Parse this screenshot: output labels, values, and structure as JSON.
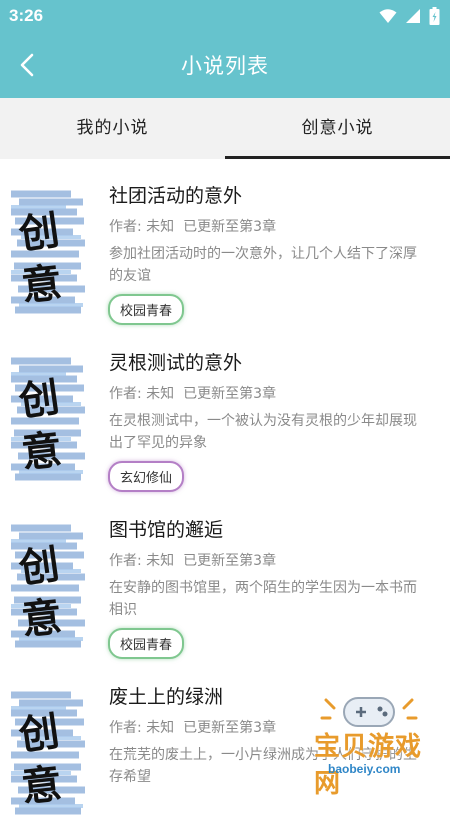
{
  "status_bar": {
    "time": "3:26"
  },
  "app_bar": {
    "title": "小说列表"
  },
  "tabs": [
    {
      "label": "我的小说",
      "active": false
    },
    {
      "label": "创意小说",
      "active": true
    }
  ],
  "cover_text": [
    "创",
    "意"
  ],
  "novels": [
    {
      "title": "社团活动的意外",
      "author": "作者: 未知",
      "update": "已更新至第3章",
      "description": "参加社团活动时的一次意外，让几个人结下了深厚的友谊",
      "tag": "校园青春",
      "tag_color": "#7fc78f"
    },
    {
      "title": "灵根测试的意外",
      "author": "作者: 未知",
      "update": "已更新至第3章",
      "description": "在灵根测试中，一个被认为没有灵根的少年却展现出了罕见的异象",
      "tag": "玄幻修仙",
      "tag_color": "#b47fc6"
    },
    {
      "title": "图书馆的邂逅",
      "author": "作者: 未知",
      "update": "已更新至第3章",
      "description": "在安静的图书馆里，两个陌生的学生因为一本书而相识",
      "tag": "校园青春",
      "tag_color": "#7fc78f"
    },
    {
      "title": "废土上的绿洲",
      "author": "作者: 未知",
      "update": "已更新至第3章",
      "description": "在荒芜的废土上，一小片绿洲成为了人们守护的生存希望",
      "tag": "",
      "tag_color": "#66c3cd"
    }
  ],
  "watermark": {
    "text": "宝贝游戏网",
    "url": "baobeiy.com"
  },
  "colors": {
    "accent": "#66c3cd"
  }
}
